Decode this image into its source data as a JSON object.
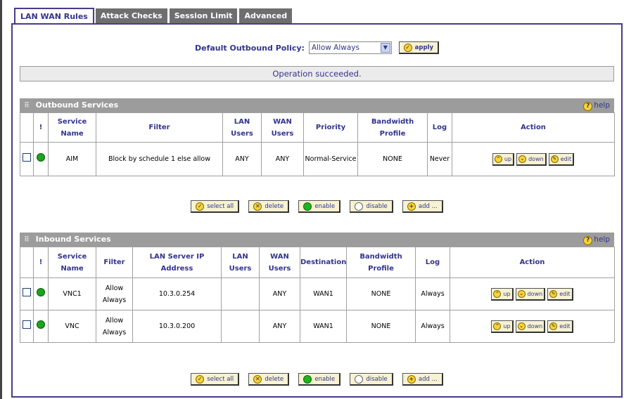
{
  "tabs": [
    "LAN WAN Rules",
    "Attack Checks",
    "Session Limit",
    "Advanced"
  ],
  "policy": {
    "label": "Default Outbound Policy:",
    "value": "Allow Always",
    "apply": "apply"
  },
  "status": "Operation succeeded.",
  "outbound": {
    "title": "Outbound Services",
    "help": "help",
    "headers": [
      "",
      "!",
      "Service Name",
      "Filter",
      "LAN Users",
      "WAN Users",
      "Priority",
      "Bandwidth Profile",
      "Log",
      "Action"
    ],
    "rows": [
      {
        "service": "AIM",
        "filter": "Block by schedule 1 else allow",
        "lan": "ANY",
        "wan": "ANY",
        "priority": "Normal-Service",
        "bandwidth": "NONE",
        "log": "Never"
      }
    ]
  },
  "inbound": {
    "title": "Inbound Services",
    "help": "help",
    "headers": [
      "",
      "!",
      "Service Name",
      "Filter",
      "LAN Server IP Address",
      "LAN Users",
      "WAN Users",
      "Destination",
      "Bandwidth Profile",
      "Log",
      "Action"
    ],
    "rows": [
      {
        "service": "VNC1",
        "filter": "Allow Always",
        "ip": "10.3.0.254",
        "lan": "",
        "wan": "ANY",
        "dest": "WAN1",
        "bandwidth": "NONE",
        "log": "Always"
      },
      {
        "service": "VNC",
        "filter": "Allow Always",
        "ip": "10.3.0.200",
        "lan": "",
        "wan": "ANY",
        "dest": "WAN1",
        "bandwidth": "NONE",
        "log": "Always"
      }
    ]
  },
  "row_actions": {
    "up": "up",
    "down": "down",
    "edit": "edit"
  },
  "bulk_actions": {
    "select_all": "select all",
    "delete": "delete",
    "enable": "enable",
    "disable": "disable",
    "add": "add ..."
  }
}
